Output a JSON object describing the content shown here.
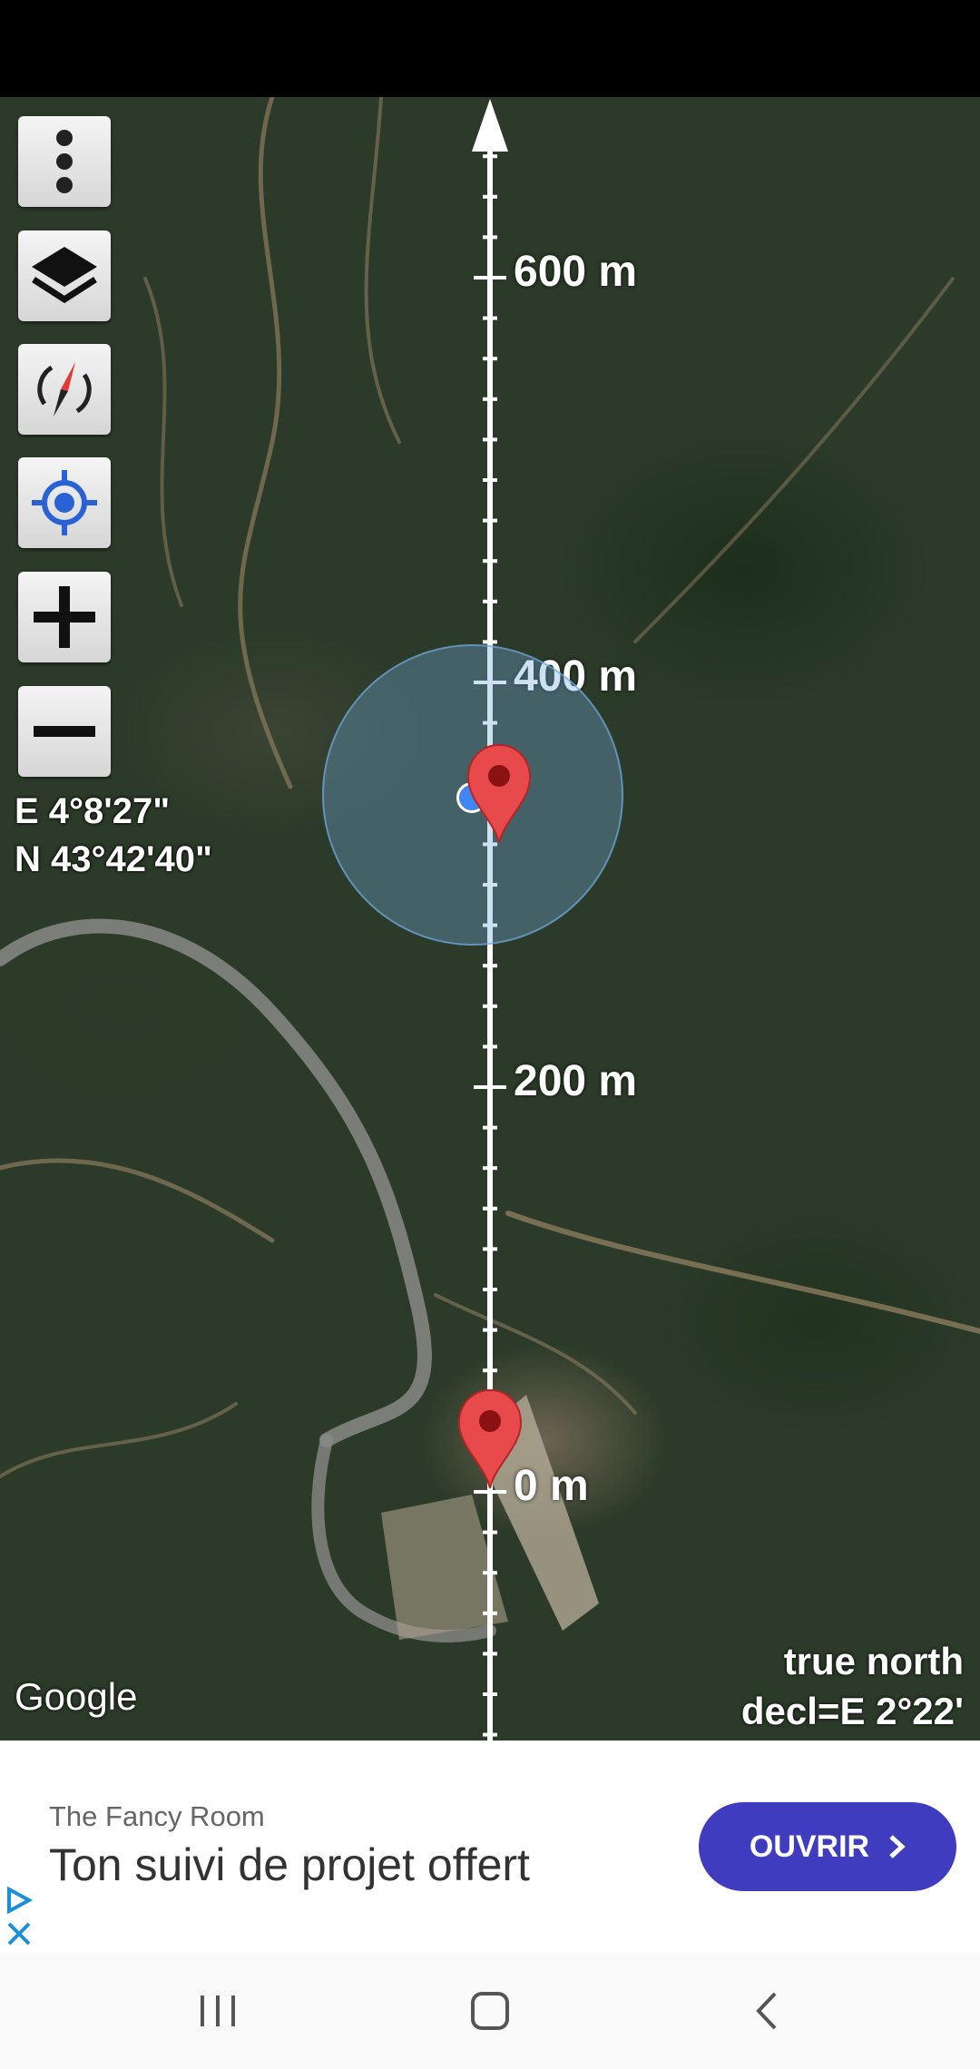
{
  "map": {
    "coordinates": {
      "longitude": "E 4°8'27\"",
      "latitude": "N 43°42'40\""
    },
    "scale_labels": [
      "600 m",
      "400 m",
      "200 m",
      "0 m"
    ],
    "attribution": "Google",
    "north_reference": "true north",
    "declination": "decl=E 2°22'",
    "controls": [
      "more-menu-icon",
      "layers-icon",
      "compass-rotate-icon",
      "my-location-icon",
      "zoom-in-icon",
      "zoom-out-icon"
    ],
    "colors": {
      "marker": "#e53935",
      "accuracy_circle": "#6fa8dc",
      "location_dot": "#4285f4"
    }
  },
  "ad": {
    "advertiser": "The Fancy Room",
    "headline": "Ton suivi de projet offert",
    "button_label": "OUVRIR",
    "accent": "#3f3cbf"
  },
  "navbar": {
    "buttons": [
      "recent-apps-icon",
      "home-icon",
      "back-icon"
    ]
  }
}
